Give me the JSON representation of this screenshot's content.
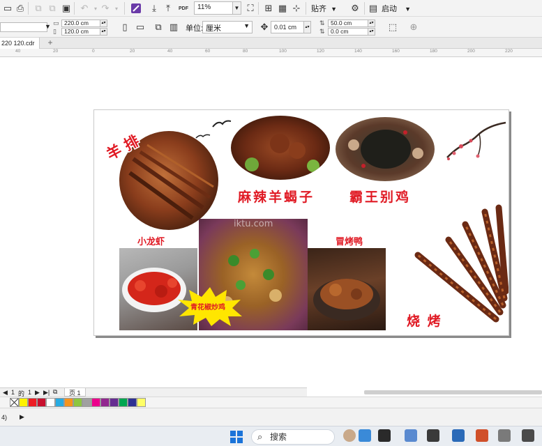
{
  "toolbar": {
    "pdf_label": "PDF",
    "zoom_value": "11%",
    "snap_label": "贴齐",
    "launch_label": "启动"
  },
  "property_bar": {
    "width": "220.0 cm",
    "height": "120.0 cm",
    "unit_label": "单位:",
    "unit_value": "厘米",
    "nudge": "0.01 cm",
    "dup_x": "50.0 cm",
    "dup_y": "0.0 cm"
  },
  "document_tab": {
    "name": "220  120.cdr"
  },
  "ruler_ticks": [
    "40",
    "20",
    "0",
    "20",
    "40",
    "60",
    "80",
    "100",
    "120",
    "140",
    "160",
    "180",
    "200",
    "220"
  ],
  "design": {
    "title_lamb_ribs": "羊 排",
    "spicy_lamb": "麻辣羊蝎子",
    "bawang_chicken": "霸王别鸡",
    "crayfish": "小龙虾",
    "green_pepper_chicken": "青花椒炒鸡",
    "braised_duck": "冒烤鸭",
    "bbq": "烧 烤",
    "watermark": "iktu.com"
  },
  "page_nav": {
    "current": "1",
    "of_label": "的",
    "total": "1",
    "page_tab": "页 1"
  },
  "palette": [
    "#ffffff",
    "#fff200",
    "#ed1c24",
    "#c8102e",
    "#ffffff",
    "#29abe2",
    "#f7941d",
    "#8dc63f",
    "#a0a0a0",
    "#ec008c",
    "#92278f",
    "#662d91",
    "#00a651",
    "#2e3192",
    "#ffff66"
  ],
  "status": {
    "left_text": "4)"
  },
  "taskbar": {
    "search_placeholder": "搜索"
  }
}
